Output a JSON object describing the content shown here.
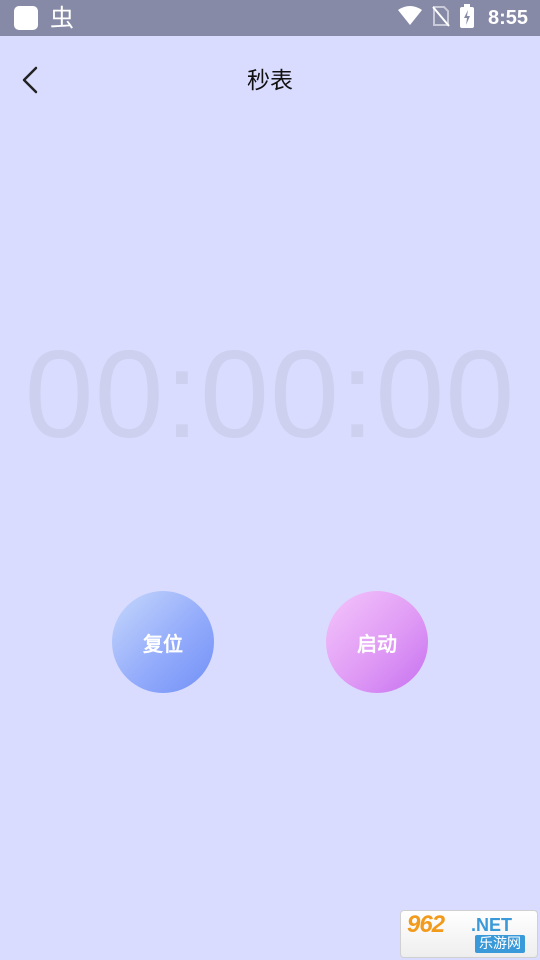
{
  "status_bar": {
    "time": "8:55",
    "app_icon_2": "虫",
    "icons": [
      "wifi-icon",
      "no-sim-icon",
      "battery-charging-icon"
    ]
  },
  "header": {
    "title": "秒表",
    "back_icon": "chevron-left-icon"
  },
  "stopwatch": {
    "display": "00:00:00"
  },
  "buttons": {
    "reset_label": "复位",
    "start_label": "启动"
  },
  "watermark": {
    "brand": "962",
    "suffix": ".NET",
    "caption": "乐游网"
  },
  "colors": {
    "background": "#dadcff",
    "status_bar": "#868aa6",
    "timer_text": "#cdd0ef",
    "reset_gradient_end": "#7190f7",
    "start_gradient_end": "#c670f0"
  }
}
